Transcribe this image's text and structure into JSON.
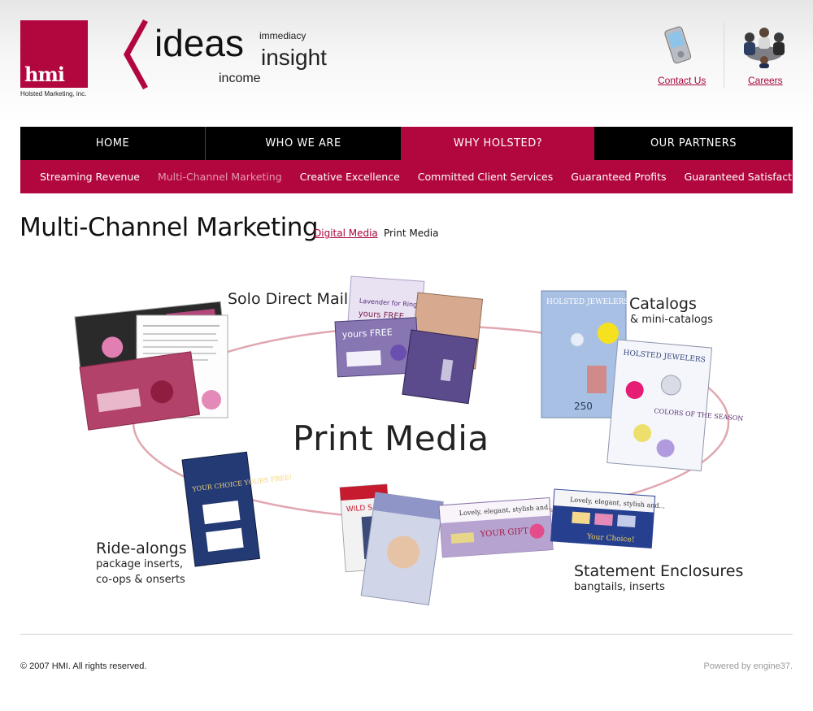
{
  "brand": {
    "logo_text": "hmi",
    "company_name": "Holsted Marketing, inc.",
    "accent_color": "#b2063f"
  },
  "tagline": {
    "ideas": "ideas",
    "immediacy": "immediacy",
    "insight": "insight",
    "income": "income"
  },
  "header_links": {
    "contact": "Contact Us",
    "contact_icon": "pda-phone-icon",
    "careers": "Careers",
    "careers_icon": "business-meeting-icon"
  },
  "nav": {
    "items": [
      {
        "label": "HOME"
      },
      {
        "label": "WHO WE ARE"
      },
      {
        "label": "WHY HOLSTED?"
      },
      {
        "label": "OUR PARTNERS"
      }
    ],
    "active": "WHY HOLSTED?"
  },
  "subnav": {
    "items": [
      {
        "label": "Streaming Revenue"
      },
      {
        "label": "Multi-Channel Marketing"
      },
      {
        "label": "Creative Excellence"
      },
      {
        "label": "Committed Client Services"
      },
      {
        "label": "Guaranteed Profits"
      },
      {
        "label": "Guaranteed Satisfaction"
      }
    ],
    "current": "Multi-Channel Marketing"
  },
  "page": {
    "title": "Multi-Channel Marketing",
    "tab_digital": "Digital Media",
    "tab_print": "Print Media"
  },
  "diagram": {
    "center": "Print Media",
    "solo_direct_mail": "Solo Direct Mail",
    "catalogs": "Catalogs",
    "catalogs_sub": "& mini-catalogs",
    "ride_alongs": "Ride-alongs",
    "ride_alongs_sub1": "package inserts,",
    "ride_alongs_sub2": "co-ops & onserts",
    "statement": "Statement Enclosures",
    "statement_sub": "bangtails, inserts",
    "samples": {
      "yours_free": "yours FREE",
      "holsted_jewelers": "HOLSTED JEWELERS",
      "colors_season": "COLORS OF THE SEASON",
      "your_choice": "YOUR CHOICE YOURS FREE!",
      "wild_safari": "WILD SAFARI",
      "your_gift": "YOUR GIFT",
      "lovely": "Lovely, elegant, stylish and...",
      "your_choice_short": "Your Choice!"
    }
  },
  "footer": {
    "copyright": "© 2007 HMI. All rights reserved.",
    "powered_by": "Powered by engine37."
  }
}
